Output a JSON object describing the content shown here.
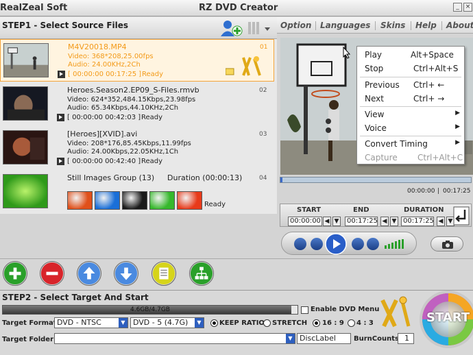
{
  "window": {
    "brand": "RealZeal Soft",
    "title": "RZ DVD Creator",
    "minimize_glyph": "_",
    "close_glyph": "×"
  },
  "step1": {
    "title": "STEP1 - Select Source Files",
    "icons": [
      "add-user-icon",
      "list-view-icon"
    ]
  },
  "sources": [
    {
      "name": "M4V20018.MP4",
      "video": "Video: 368*208,25.00fps",
      "audio": "Audio: 24.00KHz,2Ch",
      "time": "[ 00:00:00  00:17:25 ]",
      "status": "Ready",
      "num": "01",
      "selected": true
    },
    {
      "name": "Heroes.Season2.EP09_S-Files.rmvb",
      "video": "Video: 624*352,484.15Kbps,23.98fps",
      "audio": "Audio: 65.34Kbps,44.10KHz,2Ch",
      "time": "[ 00:00:00  00:42:03 ]",
      "status": "Ready",
      "num": "02",
      "selected": false
    },
    {
      "name": "[Heroes][XVID].avi",
      "video": "Video: 208*176,85.45Kbps,11.99fps",
      "audio": "Audio: 24.00Kbps,22.05KHz,1Ch",
      "time": "[ 00:00:00  00:42:40 ]",
      "status": "Ready",
      "num": "03",
      "selected": false
    }
  ],
  "still_group": {
    "name": "Still Images Group (13)",
    "duration": "Duration (00:00:13)",
    "status": "Ready",
    "num": "04",
    "thumb_colors": [
      "#e0501a",
      "#1a6fd8",
      "#1a1a1a",
      "#36b82c",
      "#e83a1a"
    ]
  },
  "menu": {
    "items": [
      "Option",
      "Languages",
      "Skins",
      "Help",
      "About"
    ]
  },
  "context_menu": {
    "items": [
      {
        "label": "Play",
        "shortcut": "Alt+Space"
      },
      {
        "label": "Stop",
        "shortcut": "Ctrl+Alt+S"
      },
      {
        "label": "Previous",
        "shortcut": "Ctrl+ ←"
      },
      {
        "label": "Next",
        "shortcut": "Ctrl+ →"
      },
      {
        "label": "View",
        "submenu": true
      },
      {
        "label": "Voice",
        "submenu": true
      },
      {
        "label": "Convert Timing",
        "submenu": true
      },
      {
        "label": "Capture",
        "shortcut": "Ctrl+Alt+C",
        "disabled": true
      }
    ]
  },
  "player": {
    "current_time": "00:00:00",
    "total_time": "00:17:25",
    "seek_fraction": 0.01
  },
  "trim": {
    "start_label": "START",
    "end_label": "END",
    "duration_label": "DURATION",
    "start": "00:00:00",
    "end": "00:17:25",
    "duration": "00:17:25"
  },
  "action_icons": [
    "add-icon",
    "remove-icon",
    "move-up-icon",
    "move-down-icon",
    "edit-icon",
    "tree-icon"
  ],
  "step2": {
    "title": "STEP2 - Select Target And Start",
    "size_text": "4.6GB/4.7GB",
    "size_fraction": 0.98,
    "enable_menu_label": "Enable DVD Menu",
    "target_format_label": "Target Format",
    "format_value": "DVD - NTSC",
    "size_value": "DVD - 5 (4.7G)",
    "keep_ratio_label": "KEEP RATIO",
    "stretch_label": "STRETCH",
    "ratio_169_label": "16 : 9",
    "ratio_43_label": "4 : 3",
    "target_folder_label": "Target  Folder",
    "folder_value": "",
    "disc_label": "DiscLabel",
    "burn_counts_label": "BurnCounts:",
    "burn_counts_value": "1",
    "start_label": "START"
  }
}
